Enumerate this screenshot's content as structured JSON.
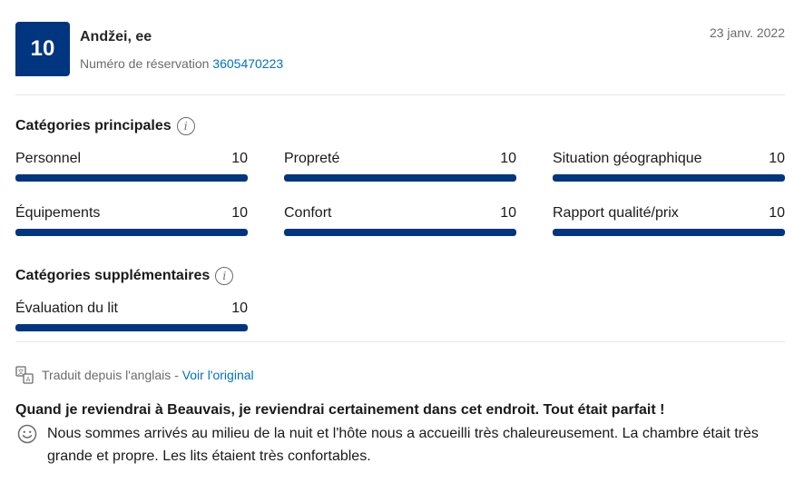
{
  "review": {
    "score": "10",
    "reviewer_name": "Andžei, ee",
    "booking_label": "Numéro de réservation",
    "booking_number": "3605470223",
    "date": "23 janv. 2022"
  },
  "main_categories": {
    "title": "Catégories principales",
    "items": [
      {
        "label": "Personnel",
        "score": "10",
        "fill": 1.0
      },
      {
        "label": "Propreté",
        "score": "10",
        "fill": 1.0
      },
      {
        "label": "Situation géographique",
        "score": "10",
        "fill": 1.0
      },
      {
        "label": "Équipements",
        "score": "10",
        "fill": 1.0
      },
      {
        "label": "Confort",
        "score": "10",
        "fill": 1.0
      },
      {
        "label": "Rapport qualité/prix",
        "score": "10",
        "fill": 1.0
      }
    ]
  },
  "extra_categories": {
    "title": "Catégories supplémentaires",
    "items": [
      {
        "label": "Évaluation du lit",
        "score": "10",
        "fill": 1.0
      }
    ]
  },
  "translation": {
    "text": "Traduit depuis l'anglais -",
    "link": "Voir l'original"
  },
  "review_body": {
    "title": "Quand je reviendrai à Beauvais, je reviendrai certainement dans cet endroit. Tout était parfait !",
    "positive_text": "Nous sommes arrivés au milieu de la nuit et l'hôte nous a accueilli très chaleureusement. La chambre était très grande et propre. Les lits étaient très confortables."
  },
  "colors": {
    "brand": "#003580",
    "link": "#0071c2",
    "muted": "#6b6b6b"
  },
  "icons": [
    "info-icon",
    "translate-icon",
    "smile-icon"
  ]
}
